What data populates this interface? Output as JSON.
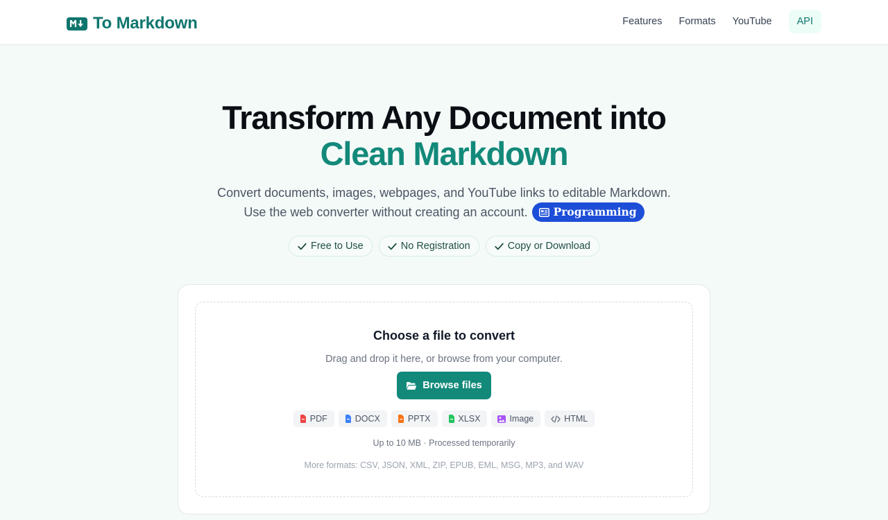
{
  "header": {
    "logo_text": "To Markdown",
    "nav": [
      {
        "label": "Features"
      },
      {
        "label": "Formats"
      },
      {
        "label": "YouTube"
      }
    ],
    "api_label": "API"
  },
  "hero": {
    "title_line1": "Transform Any Document into",
    "title_line2": "Clean Markdown",
    "subtitle_line1": "Convert documents, images, webpages, and YouTube links to editable Markdown.",
    "subtitle_line2": "Use the web converter without creating an account.",
    "badge_label": "Programming",
    "pills": [
      {
        "label": "Free to Use"
      },
      {
        "label": "No Registration"
      },
      {
        "label": "Copy or Download"
      }
    ]
  },
  "upload": {
    "title": "Choose a file to convert",
    "subtitle": "Drag and drop it here, or browse from your computer.",
    "browse_label": "Browse files",
    "formats": [
      {
        "label": "PDF",
        "icon": "pdf-file-icon",
        "color": "#ef4444"
      },
      {
        "label": "DOCX",
        "icon": "docx-file-icon",
        "color": "#3b82f6"
      },
      {
        "label": "PPTX",
        "icon": "pptx-file-icon",
        "color": "#f97316"
      },
      {
        "label": "XLSX",
        "icon": "xlsx-file-icon",
        "color": "#22c55e"
      },
      {
        "label": "Image",
        "icon": "image-icon",
        "color": "#a855f7"
      },
      {
        "label": "HTML",
        "icon": "code-icon",
        "color": "#6b7280"
      }
    ],
    "limit_note": "Up to 10 MB · Processed temporarily",
    "more_formats": "More formats: CSV, JSON, XML, ZIP, EPUB, EML, MSG, MP3, and WAV"
  },
  "colors": {
    "brand": "#0f766e",
    "accent": "#13897a",
    "badge_blue": "#1d4ed8"
  }
}
